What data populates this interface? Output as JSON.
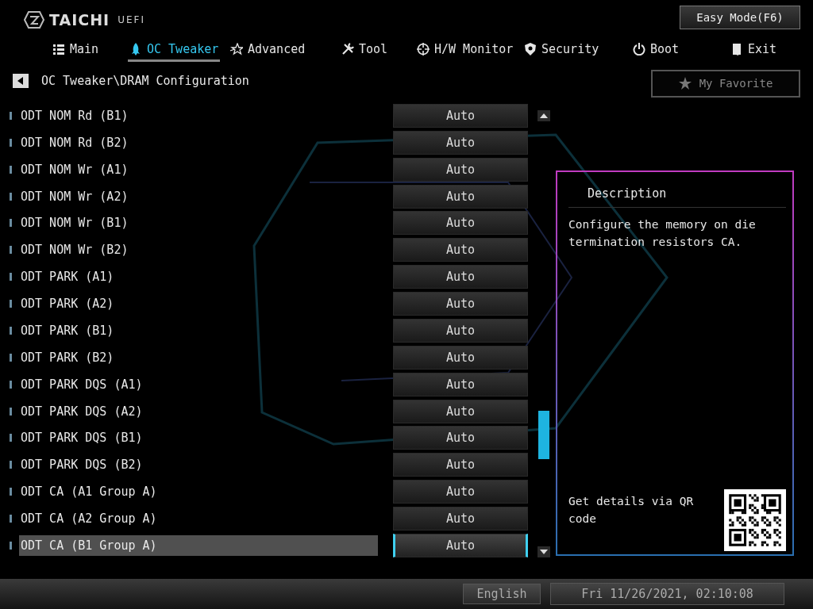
{
  "logo": {
    "brand": "TAICHI",
    "suffix": "UEFI"
  },
  "easy_mode_button": "Easy Mode(F6)",
  "tabs": [
    {
      "label": "Main",
      "selected": false
    },
    {
      "label": "OC Tweaker",
      "selected": true
    },
    {
      "label": "Advanced",
      "selected": false
    },
    {
      "label": "Tool",
      "selected": false
    },
    {
      "label": "H/W Monitor",
      "selected": false
    },
    {
      "label": "Security",
      "selected": false
    },
    {
      "label": "Boot",
      "selected": false
    },
    {
      "label": "Exit",
      "selected": false
    }
  ],
  "breadcrumb": "OC Tweaker\\DRAM Configuration",
  "favorite_button": "My Favorite",
  "settings": [
    {
      "label": "ODT NOM Rd (B1)",
      "value": "Auto",
      "selected": false
    },
    {
      "label": "ODT NOM Rd (B2)",
      "value": "Auto",
      "selected": false
    },
    {
      "label": "ODT NOM Wr (A1)",
      "value": "Auto",
      "selected": false
    },
    {
      "label": "ODT NOM Wr (A2)",
      "value": "Auto",
      "selected": false
    },
    {
      "label": "ODT NOM Wr (B1)",
      "value": "Auto",
      "selected": false
    },
    {
      "label": "ODT NOM Wr (B2)",
      "value": "Auto",
      "selected": false
    },
    {
      "label": "ODT PARK (A1)",
      "value": "Auto",
      "selected": false
    },
    {
      "label": "ODT PARK (A2)",
      "value": "Auto",
      "selected": false
    },
    {
      "label": "ODT PARK (B1)",
      "value": "Auto",
      "selected": false
    },
    {
      "label": "ODT PARK (B2)",
      "value": "Auto",
      "selected": false
    },
    {
      "label": "ODT PARK DQS (A1)",
      "value": "Auto",
      "selected": false
    },
    {
      "label": "ODT PARK DQS (A2)",
      "value": "Auto",
      "selected": false
    },
    {
      "label": "ODT PARK DQS (B1)",
      "value": "Auto",
      "selected": false
    },
    {
      "label": "ODT PARK DQS (B2)",
      "value": "Auto",
      "selected": false
    },
    {
      "label": "ODT CA (A1 Group A)",
      "value": "Auto",
      "selected": false
    },
    {
      "label": "ODT CA (A2 Group A)",
      "value": "Auto",
      "selected": false
    },
    {
      "label": "ODT CA (B1 Group A)",
      "value": "Auto",
      "selected": true
    }
  ],
  "description": {
    "title": "Description",
    "text": "Configure the memory on die termination resistors CA.",
    "qr_text": "Get details via QR code"
  },
  "status_bar": {
    "language": "English",
    "datetime": "Fri 11/26/2021, 02:10:08"
  }
}
